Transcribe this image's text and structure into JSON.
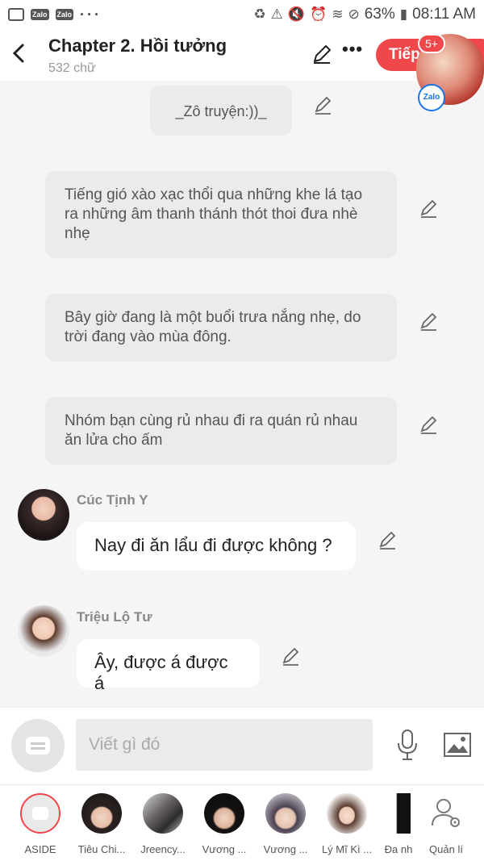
{
  "status_bar": {
    "zalo_1": "Zalo",
    "zalo_2": "Zalo",
    "battery": "63%",
    "time": "08:11 AM"
  },
  "header": {
    "title": "Chapter 2. Hồi tưởng",
    "subtitle": "532 chữ",
    "more_label": "•••",
    "next_label": "Tiếp",
    "badge": "5+",
    "zalo_badge": "Zalo"
  },
  "messages": {
    "narration_1": "_Zô truyện:))_",
    "narration_2": "Tiếng gió xào xạc thổi qua những khe lá tạo ra những âm thanh thánh thót thoi đưa nhè nhẹ",
    "narration_3": "Bây giờ đang là một buổi trưa nắng nhẹ, do trời đang vào mùa đông.",
    "narration_4": "Nhóm bạn cùng rủ nhau đi ra quán rủ nhau ăn lửa cho ấm",
    "chat_1": {
      "name": "Cúc Tịnh Y",
      "text": "Nay đi ăn lẩu đi được không ?"
    },
    "chat_2": {
      "name": "Triệu Lộ Tư",
      "text": "Ây, được á được á"
    }
  },
  "input": {
    "placeholder": "Viết gì đó"
  },
  "characters": [
    {
      "label": "ASIDE"
    },
    {
      "label": "Tiêu Chi..."
    },
    {
      "label": "Jreency..."
    },
    {
      "label": "Vương ..."
    },
    {
      "label": "Vương ..."
    },
    {
      "label": "Lý Mĩ Kì ..."
    },
    {
      "label": "Đa nh"
    },
    {
      "label": "Quản lí"
    }
  ],
  "colors": {
    "accent": "#f0474b",
    "narration_bg": "#ebebeb",
    "background": "#f5f5f5"
  }
}
